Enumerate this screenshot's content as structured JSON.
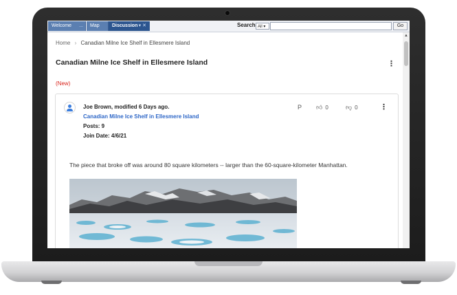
{
  "topbar": {
    "tabs": [
      {
        "label": "Welcome",
        "mini": "..."
      },
      {
        "label": "Map"
      },
      {
        "label": "Discussion",
        "mini": "▾ ✕"
      }
    ],
    "search_label": "Search:",
    "search_scope": "All ▾",
    "search_value": "",
    "go_label": "Go"
  },
  "breadcrumb": {
    "home": "Home",
    "separator": "›",
    "current": "Canadian Milne Ice Shelf in Ellesmere Island"
  },
  "page": {
    "title": "Canadian Milne Ice Shelf in Ellesmere Island",
    "badge": "(New)",
    "menu_icon": "⋮"
  },
  "post": {
    "author_line": "Joe Brown, modified 6 Days ago.",
    "thread_link": "Canadian Milne Ice Shelf in Ellesmere Island",
    "posts": "Posts: 9",
    "join_date": "Join Date: 4/6/21",
    "p_mark": "P",
    "likes": "0",
    "dislikes": "0",
    "menu_icon": "⋮",
    "body": "The piece that broke off was around 80 square kilometers -- larger than the 60-square-kilometer Manhattan.",
    "image_icon": "arctic-landscape-photo"
  },
  "colors": {
    "accent": "#2c558f",
    "link": "#2e67c7",
    "new": "#d9241c"
  }
}
